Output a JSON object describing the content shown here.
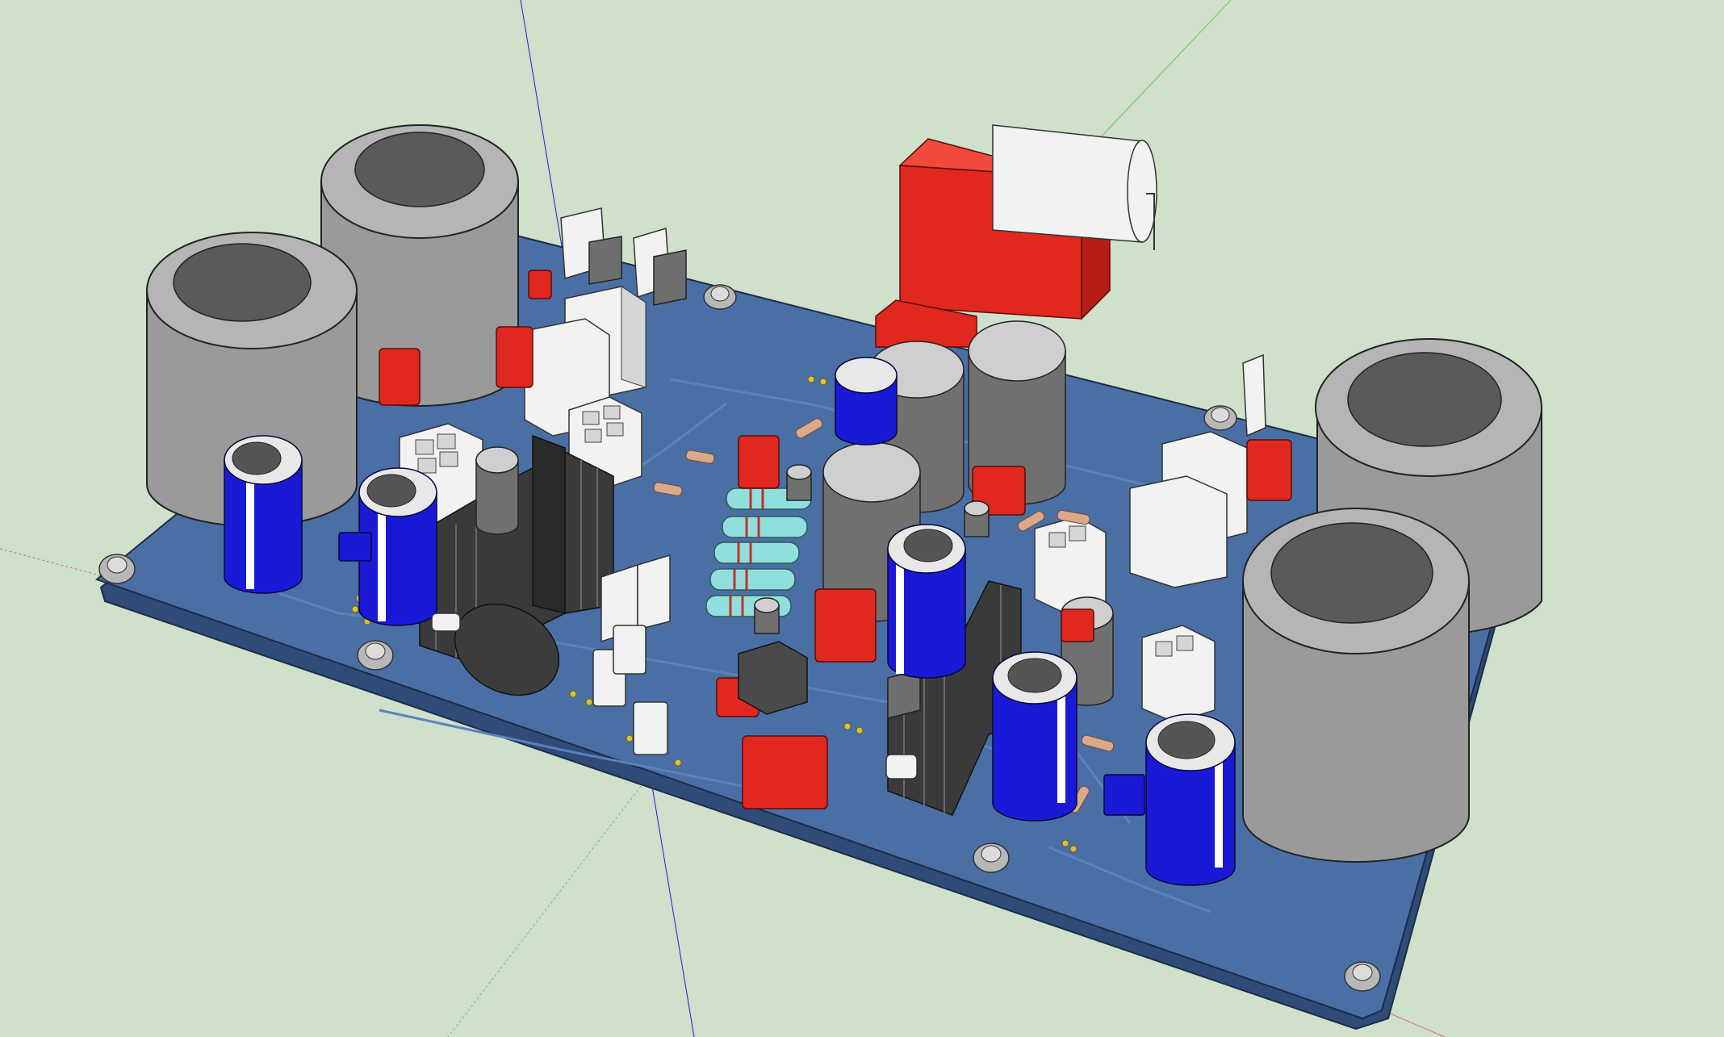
{
  "viewport": {
    "background_color": "#cfe0cb",
    "axes": {
      "red_axis_color": "#c87878",
      "green_axis_color": "#64c864",
      "blue_axis_color": "#2020d0"
    }
  },
  "model": {
    "board_color": "#4a6fa5",
    "board_edge_color": "#2f4b78",
    "trace_color": "#5b82ba",
    "pad_color": "#d9c23a",
    "palette": {
      "large_capacitor": "#9a9a9a",
      "blue_capacitor": "#1a1ad6",
      "blue_capacitor_stripe": "#ffffff",
      "dark_capacitor": "#707070",
      "red_film_capacitor": "#e0281e",
      "white_connector": "#f2f2f2",
      "heatsink": "#3a3a3a",
      "resistor_body": "#8fe0dc",
      "small_resistor": "#d9a98a",
      "mounting_screw": "#b8b8b8"
    }
  }
}
